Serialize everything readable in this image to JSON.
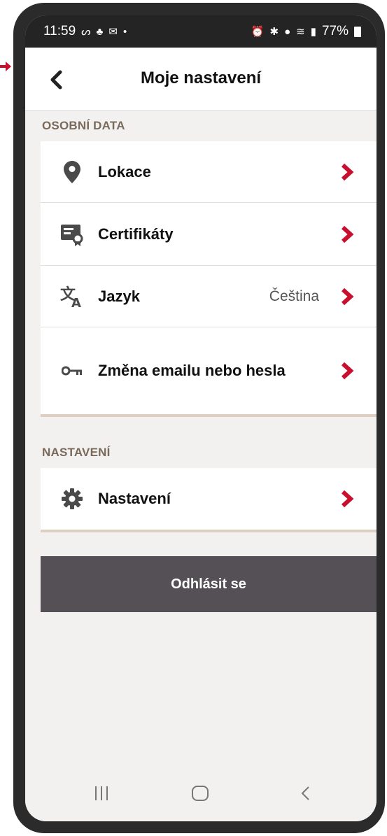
{
  "status_bar": {
    "time": "11:59",
    "left_icons": [
      "notification-f-icon",
      "notification-app-icon",
      "notification-message-icon",
      "dot-icon"
    ],
    "right_icons": [
      "alarm-icon",
      "bluetooth-icon",
      "location-icon",
      "wifi-icon",
      "signal-icon"
    ],
    "battery": "77%"
  },
  "header": {
    "title": "Moje nastavení",
    "back_icon": "chevron-left-icon"
  },
  "sections": [
    {
      "label": "OSOBNÍ DATA",
      "items": [
        {
          "label": "Lokace",
          "icon": "location-pin-icon",
          "value": ""
        },
        {
          "label": "Certifikáty",
          "icon": "certificate-icon",
          "value": ""
        },
        {
          "label": "Jazyk",
          "icon": "translate-icon",
          "value": "Čeština"
        },
        {
          "label": "Změna emailu nebo hesla",
          "icon": "key-icon",
          "value": ""
        }
      ]
    },
    {
      "label": "NASTAVENÍ",
      "items": [
        {
          "label": "Nastavení",
          "icon": "gear-icon",
          "value": ""
        }
      ]
    }
  ],
  "logout_label": "Odhlásit se",
  "colors": {
    "accent": "#c8102e",
    "section_label": "#7a6a5c",
    "logout_bg": "#545055",
    "background": "#f2f1ef"
  }
}
